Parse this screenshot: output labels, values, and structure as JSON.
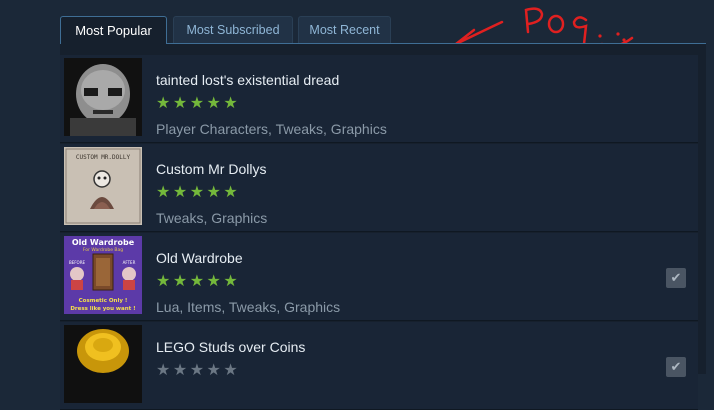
{
  "tabs": [
    {
      "label": "Most Popular",
      "active": true
    },
    {
      "label": "Most Subscribed",
      "active": false
    },
    {
      "label": "Most Recent",
      "active": false
    }
  ],
  "annotation": {
    "text": "Pog",
    "color": "#e02020"
  },
  "items": [
    {
      "title": "tainted lost's existential dread",
      "stars": "★★★★★",
      "tags": "Player Characters, Tweaks, Graphics",
      "subscribed": false
    },
    {
      "title": "Custom Mr Dollys",
      "stars": "★★★★★",
      "tags": "Tweaks, Graphics",
      "subscribed": false,
      "thumb_text": "CUSTOM MR.DOLLY"
    },
    {
      "title": "Old Wardrobe",
      "stars": "★★★★★",
      "tags": "Lua, Items, Tweaks, Graphics",
      "subscribed": true,
      "check": "✔",
      "thumb_title": "Old Wardrobe",
      "thumb_sub": "For Wardrobe Bag",
      "thumb_before": "BEFORE",
      "thumb_after": "AFTER",
      "thumb_note1": "Cosmetic Only !",
      "thumb_note2": "Dress like you want !"
    },
    {
      "title": "LEGO Studs over Coins",
      "stars": "★★★★★",
      "tags": "",
      "subscribed": true,
      "check": "✔"
    }
  ],
  "colors": {
    "star": "#74b83b",
    "tab_active_border": "#3f6e95",
    "background": "#1b2838"
  }
}
